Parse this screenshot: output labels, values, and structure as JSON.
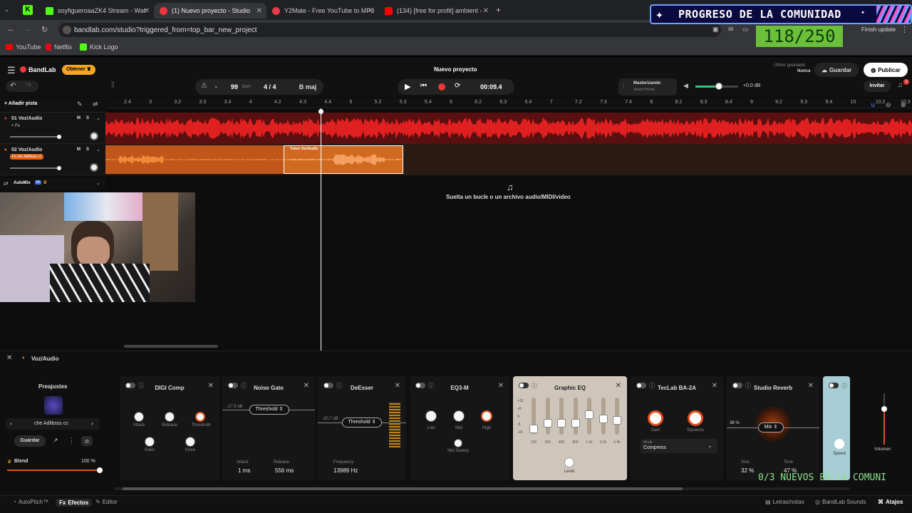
{
  "browser": {
    "tabs": [
      {
        "label": "soyfigueroaaZK4 Stream - Wat",
        "color": "#53fc18"
      },
      {
        "label": "(1) Nuevo proyecto - Studio",
        "color": "#f0353d"
      },
      {
        "label": "Y2Mate - Free YouTube to MP3",
        "color": "#e33b4a"
      },
      {
        "label": "(134) [free for profit] ambient -",
        "color": "#ff0000"
      }
    ],
    "url": "bandlab.com/studio?triggered_from=top_bar_new_project",
    "finish_update": "Finish update",
    "bookmarks": [
      "YouTube",
      "Netflix",
      "Kick Logo"
    ]
  },
  "overlay": {
    "banner": "PROGRESO DE LA COMUNIDAD",
    "counter": "118/250",
    "ticker": "0/3 NUEVOS EN LA COMUNI"
  },
  "app": {
    "brand": "BandLab",
    "obtener": "Obtener",
    "project_title": "Nuevo proyecto",
    "last_saved_label": "Último guardado",
    "last_saved_value": "Nunca",
    "save": "Guardar",
    "publish": "Publicar",
    "invite": "Invitar",
    "notif_count": "2",
    "bpm": "99",
    "bpm_unit": "bpm",
    "time_sig": "4 / 4",
    "key": "B maj",
    "time": "00:09.4",
    "mastering_title": "Masterizando",
    "mastering_sub": "Select Preset",
    "volume_db": "+0.0 dB",
    "add_track": "Añadir pista",
    "ruler": [
      "2.4",
      "3",
      "3.2",
      "3.3",
      "3.4",
      "4",
      "4.2",
      "4.3",
      "4.4",
      "5",
      "5.2",
      "5.3",
      "5.4",
      "6",
      "6.2",
      "6.3",
      "6.4",
      "7",
      "7.2",
      "7.3",
      "7.4",
      "8",
      "8.2",
      "8.3",
      "8.4",
      "9",
      "9.2",
      "9.3",
      "9.4",
      "10",
      "10.2",
      "10.3"
    ],
    "tracks": [
      {
        "name": "01 Voz/Audio",
        "fx": "+ Fx",
        "m": "M",
        "s": "S"
      },
      {
        "name": "02 Voz/Audio",
        "fx": "Fx che Adlibsss cc",
        "m": "M",
        "s": "S"
      }
    ],
    "clip_label": "Tokes  Voz/Audio",
    "automix": "AutoMix",
    "automix_badge": "IA",
    "drop_text": "Suelta un bucle o un archivo audio/MIDI/video"
  },
  "fx": {
    "track": "Voz/Audio",
    "presets_title": "Preajustes",
    "preset_name": "che Adlibsss cc",
    "save": "Guardar",
    "blend_label": "Blend",
    "blend_value": "100 %",
    "blend_fraction": 1.0,
    "cards": {
      "comp": {
        "title": "DIGI Comp",
        "knobs": [
          "Attack",
          "Release",
          "Threshold",
          "Ratio",
          "Knee"
        ]
      },
      "gate": {
        "title": "Noise Gate",
        "db": "-27.9 dB",
        "threshold": "Threshold",
        "attack_label": "Attack",
        "attack": "1 ms",
        "release_label": "Release",
        "release": "556 ms"
      },
      "deesser": {
        "title": "DeEsser",
        "db": "-20.7 dB",
        "threshold": "Threshold",
        "freq_label": "Frequency",
        "freq": "13989 Hz"
      },
      "eq3": {
        "title": "EQ3-M",
        "knobs": [
          "Low",
          "Mid",
          "High"
        ],
        "sweep": "Mid Sweep"
      },
      "geq": {
        "title": "Graphic EQ",
        "scale": [
          "+15",
          "+5",
          "0",
          "-5",
          "-15"
        ],
        "bands": [
          "100",
          "200",
          "400",
          "800",
          "1.6k",
          "3.2k",
          "6.4k"
        ],
        "level": "Level"
      },
      "ba2a": {
        "title": "TecLab BA-2A",
        "knobs": [
          "Gain",
          "Squeeze"
        ],
        "mode_label": "Mode",
        "mode": "Compress"
      },
      "reverb": {
        "title": "Studio Reverb",
        "pct": "36 %",
        "mix": "Mix",
        "size_label": "Size",
        "size": "32 %",
        "tone_label": "Tone",
        "tone": "47 %"
      },
      "extra": {
        "speed": "Speed"
      },
      "volume": "Volumen"
    }
  },
  "bottom": {
    "autopitch": "AutoPitch™",
    "efectos": "Efectos",
    "editor": "Editor",
    "letras": "Letras/notas",
    "sounds": "BandLab Sounds",
    "atajos": "Atajos"
  }
}
